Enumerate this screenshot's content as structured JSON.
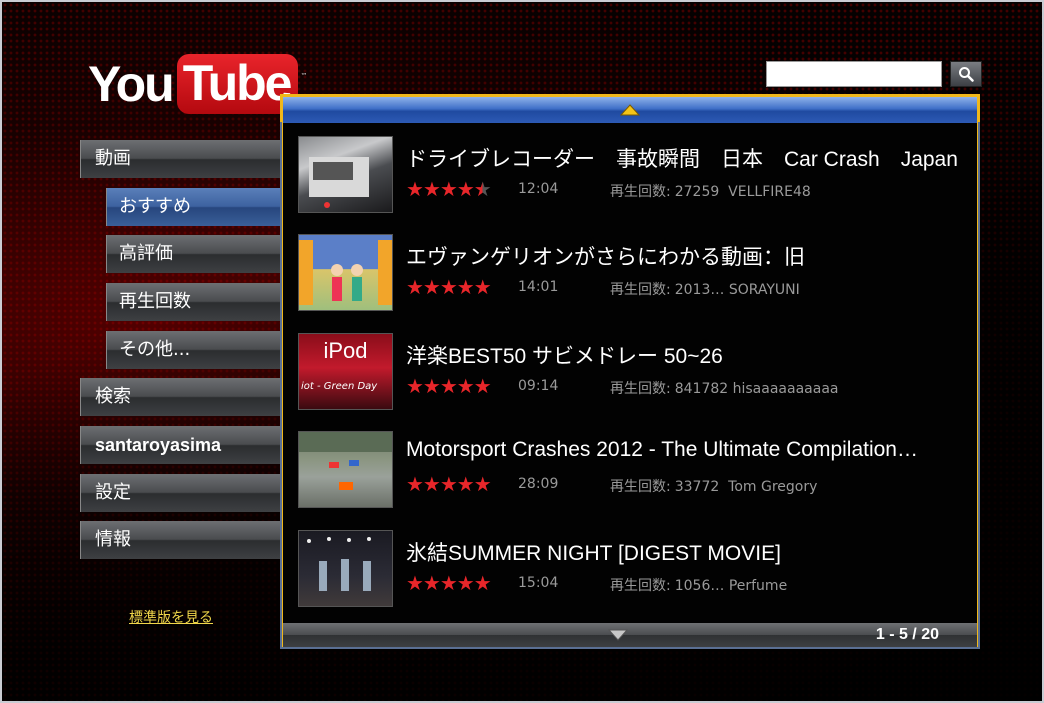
{
  "logo": {
    "you": "You",
    "tube": "Tube",
    "tm": "™"
  },
  "search": {
    "value": "",
    "placeholder": ""
  },
  "sidebar": {
    "items": [
      {
        "label": "動画"
      },
      {
        "label": "おすすめ"
      },
      {
        "label": "高評価"
      },
      {
        "label": "再生回数"
      },
      {
        "label": "その他..."
      },
      {
        "label": "検索"
      },
      {
        "label": "santaroyasima"
      },
      {
        "label": "設定"
      },
      {
        "label": "情報"
      }
    ],
    "standard_link": "標準版を見る"
  },
  "videos": [
    {
      "title": "ドライブレコーダー　事故瞬間　日本　Car Crash　Japan",
      "stars": "★★★★★",
      "rating": 4.5,
      "duration": "12:04",
      "views_label": "再生回数:",
      "views": "27259",
      "author": "VELLFIRE48"
    },
    {
      "title": "エヴァンゲリオンがさらにわかる動画：旧",
      "stars": "★★★★★",
      "rating": 5,
      "duration": "14:01",
      "views_label": "再生回数:",
      "views": "2013…",
      "author": "SORAYUNI"
    },
    {
      "title": "洋楽BEST50 サビメドレー 50~26",
      "stars": "★★★★★",
      "rating": 5,
      "duration": "09:14",
      "views_label": "再生回数:",
      "views": "841782",
      "author": "hisaaaaaaaaaa",
      "thumb_text": "iPod",
      "thumb_caption": "iot - Green Day"
    },
    {
      "title": "Motorsport Crashes 2012 - The Ultimate Compilation…",
      "stars": "★★★★★",
      "rating": 5,
      "duration": "28:09",
      "views_label": "再生回数:",
      "views": "33772",
      "author": "Tom Gregory"
    },
    {
      "title": "氷結SUMMER NIGHT [DIGEST MOVIE]",
      "stars": "★★★★★",
      "rating": 5,
      "duration": "15:04",
      "views_label": "再生回数:",
      "views": "1056…",
      "author": "Perfume"
    }
  ],
  "pagination": {
    "text": "1 - 5 / 20"
  },
  "colors": {
    "accent_blue": "#3d62a0",
    "star_red": "#e8262a",
    "panel_border": "#f0b81a",
    "link_yellow": "#f0d64a"
  },
  "icons": {
    "search": "search-icon",
    "up": "triangle-up-icon",
    "down": "triangle-down-icon"
  }
}
